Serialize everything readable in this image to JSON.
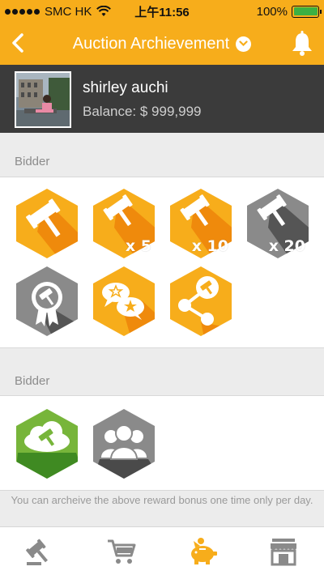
{
  "status_bar": {
    "carrier": "SMC HK",
    "time": "上午11:56",
    "battery_percent": "100%",
    "battery_level": 1.0,
    "signal_bars_filled": 5
  },
  "nav": {
    "title": "Auction Archievement",
    "back_icon": "chevron-left-icon",
    "dropdown_icon": "chevron-down-circle-icon",
    "bell_icon": "bell-icon"
  },
  "profile": {
    "name": "shirley auchi",
    "balance": "Balance: $ 999,999"
  },
  "sections": [
    {
      "label": "Bidder",
      "badges": [
        {
          "name": "gavel-badge",
          "icon": "gavel-icon",
          "label": "",
          "color": "#f7ad1b",
          "active": true
        },
        {
          "name": "gavel-x5-badge",
          "icon": "gavel-icon",
          "label": "x 5",
          "color": "#f7ad1b",
          "active": true
        },
        {
          "name": "gavel-x10-badge",
          "icon": "gavel-icon",
          "label": "x 10",
          "color": "#f7ad1b",
          "active": true
        },
        {
          "name": "gavel-x20-badge",
          "icon": "gavel-icon",
          "label": "x 20",
          "color": "#8a8a8a",
          "active": false
        },
        {
          "name": "award-ribbon-badge",
          "icon": "award-ribbon-icon",
          "label": "",
          "color": "#8a8a8a",
          "active": false
        },
        {
          "name": "review-chat-badge",
          "icon": "chat-star-icon",
          "label": "",
          "color": "#f7ad1b",
          "active": true
        },
        {
          "name": "share-badge",
          "icon": "share-icon",
          "label": "",
          "color": "#f7ad1b",
          "active": true
        }
      ]
    },
    {
      "label": "Bidder",
      "badges": [
        {
          "name": "cloud-gavel-badge",
          "icon": "cloud-gavel-icon",
          "label": "",
          "color": "#77b53a",
          "active": true
        },
        {
          "name": "group-badge",
          "icon": "group-icon",
          "label": "",
          "color": "#8a8a8a",
          "active": false
        }
      ]
    }
  ],
  "footer_note": "You can archeive the above reward bonus one time only per day.",
  "tabs": [
    {
      "name": "tab-auction",
      "icon": "gavel-icon",
      "active": false
    },
    {
      "name": "tab-cart",
      "icon": "cart-icon",
      "active": false
    },
    {
      "name": "tab-piggy-bank",
      "icon": "piggy-bank-icon",
      "active": true
    },
    {
      "name": "tab-store",
      "icon": "store-icon",
      "active": false
    }
  ],
  "colors": {
    "accent": "#f7ad1b",
    "header_dark": "#3b3b3b",
    "inactive": "#8a8a8a",
    "green": "#77b53a"
  }
}
